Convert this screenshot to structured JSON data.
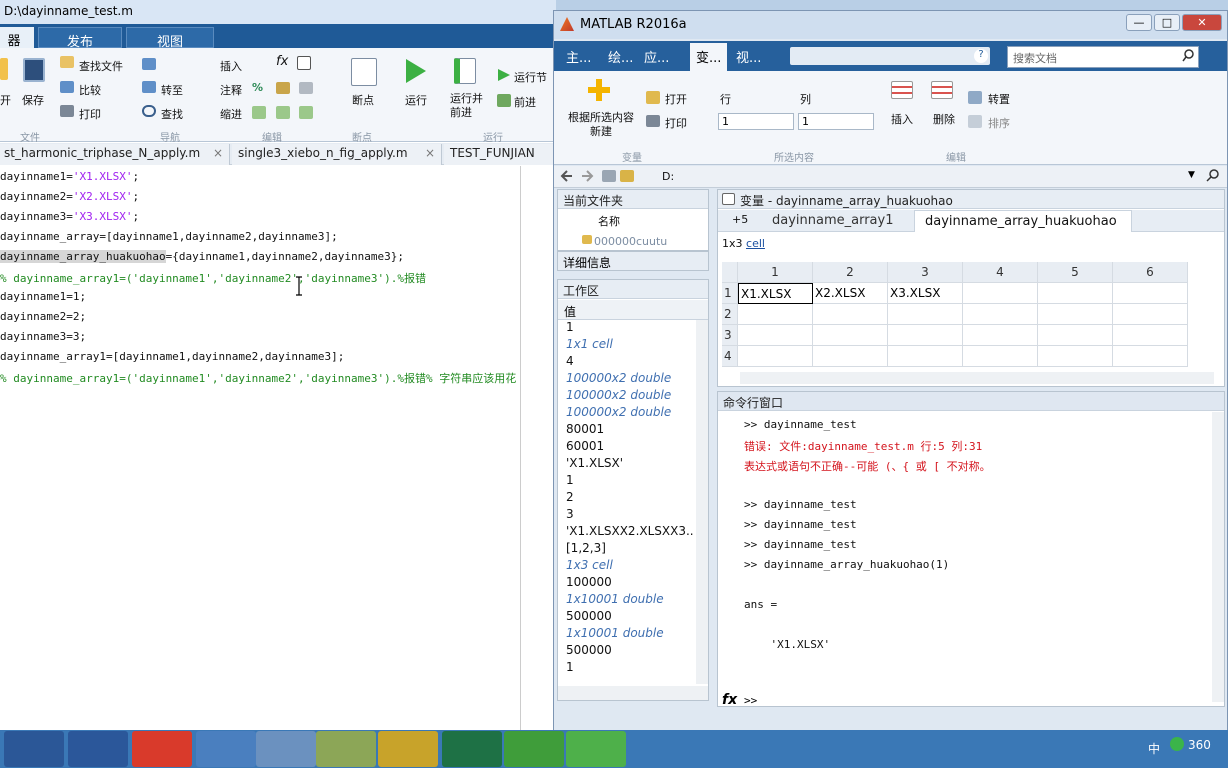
{
  "editor": {
    "title": "D:\\dayinname_test.m",
    "tabs": [
      "器",
      "发布",
      "视图"
    ],
    "ribbon": {
      "find_files": "查找文件",
      "compare": "比较",
      "print": "打印",
      "save": "保存",
      "open": "开",
      "goto": "转至",
      "find": "查找",
      "insert": "插入",
      "comment": "注释",
      "indent": "缩进",
      "breakpoint": "断点",
      "run": "运行",
      "run_advance": "运行并\n前进",
      "run_section": "运行节",
      "advance": "前进",
      "fx": "fx",
      "percent": "%",
      "groups": [
        "文件",
        "导航",
        "编辑",
        "断点",
        "运行"
      ]
    },
    "file_tabs": [
      "st_harmonic_triphase_N_apply.m",
      "single3_xiebo_n_fig_apply.m",
      "TEST_FUNJIAN"
    ],
    "file_tab_close": "×",
    "code_lines": [
      {
        "parts": [
          {
            "t": "dayinname1=",
            "c": ""
          },
          {
            "t": "'X1.XLSX'",
            "c": "st"
          },
          {
            "t": ";",
            "c": ""
          }
        ]
      },
      {
        "parts": [
          {
            "t": "dayinname2=",
            "c": ""
          },
          {
            "t": "'X2.XLSX'",
            "c": "st"
          },
          {
            "t": ";",
            "c": ""
          }
        ]
      },
      {
        "parts": [
          {
            "t": "dayinname3=",
            "c": ""
          },
          {
            "t": "'X3.XLSX'",
            "c": "st"
          },
          {
            "t": ";",
            "c": ""
          }
        ]
      },
      {
        "parts": [
          {
            "t": "dayinname_array=[dayinname1,dayinname2,dayinname3];",
            "c": ""
          }
        ]
      },
      {
        "parts": [
          {
            "t": "dayinname_array_huakuohao",
            "c": "hl"
          },
          {
            "t": "={dayinname1,dayinname2,dayinname3};",
            "c": ""
          }
        ]
      },
      {
        "parts": [
          {
            "t": "% dayinname_array1=('dayinname1','dayinname2','dayinname3').%报错",
            "c": "cm"
          }
        ]
      },
      {
        "parts": [
          {
            "t": "dayinname1=1;",
            "c": ""
          }
        ]
      },
      {
        "parts": [
          {
            "t": "dayinname2=2;",
            "c": ""
          }
        ]
      },
      {
        "parts": [
          {
            "t": "dayinname3=3;",
            "c": ""
          }
        ]
      },
      {
        "parts": [
          {
            "t": "dayinname_array1=[dayinname1,dayinname2,dayinname3];",
            "c": ""
          }
        ]
      },
      {
        "parts": [
          {
            "t": "% dayinname_array1=('dayinname1','dayinname2','dayinname3').%报错% 字符串应该用花",
            "c": "cm"
          }
        ]
      }
    ]
  },
  "matlab": {
    "title": "MATLAB R2016a",
    "tabs": [
      "主...",
      "绘...",
      "应...",
      "变...",
      "视..."
    ],
    "search_placeholder": "搜索文档",
    "ribbon": {
      "new_from_selection": "根据所选内容\n新建",
      "open": "打开",
      "print": "打印",
      "row_label": "行",
      "col_label": "列",
      "row_value": "1",
      "col_value": "1",
      "insert": "插入",
      "delete": "删除",
      "transpose": "转置",
      "sort": "排序",
      "groups": [
        "变量",
        "所选内容",
        "编辑"
      ]
    },
    "path_drive": "D:",
    "current_folder": {
      "title": "当前文件夹",
      "col_name": "名称",
      "item": "000000cuutu",
      "details": "详细信息"
    },
    "workspace": {
      "title": "工作区",
      "col_value": "值",
      "values": [
        {
          "v": "1",
          "i": false
        },
        {
          "v": "1x1 cell",
          "i": true
        },
        {
          "v": "4",
          "i": false
        },
        {
          "v": "100000x2 double",
          "i": true
        },
        {
          "v": "100000x2 double",
          "i": true
        },
        {
          "v": "100000x2 double",
          "i": true
        },
        {
          "v": "80001",
          "i": false
        },
        {
          "v": "60001",
          "i": false
        },
        {
          "v": "'X1.XLSX'",
          "i": false
        },
        {
          "v": "1",
          "i": false
        },
        {
          "v": "2",
          "i": false
        },
        {
          "v": "3",
          "i": false
        },
        {
          "v": "'X1.XLSXX2.XLSXX3...",
          "i": false
        },
        {
          "v": "[1,2,3]",
          "i": false
        },
        {
          "v": "1x3 cell",
          "i": true
        },
        {
          "v": "100000",
          "i": false
        },
        {
          "v": "1x10001 double",
          "i": true
        },
        {
          "v": "500000",
          "i": false
        },
        {
          "v": "1x10001 double",
          "i": true
        },
        {
          "v": "500000",
          "i": false
        },
        {
          "v": "1",
          "i": false
        }
      ]
    },
    "variables": {
      "title": "变量 - dayinname_array_huakuohao",
      "tab_plus": "+5",
      "tab1": "dayinname_array1",
      "tab2": "dayinname_array_huakuohao",
      "size_text": "1x3",
      "type_text": "cell",
      "col_headers": [
        "1",
        "2",
        "3",
        "4",
        "5",
        "6"
      ],
      "row_headers": [
        "1",
        "2",
        "3",
        "4"
      ],
      "row1": [
        "X1.XLSX",
        "X2.XLSX",
        "X3.XLSX",
        "",
        "",
        ""
      ]
    },
    "command": {
      "title": "命令行窗口",
      "lines": [
        {
          "t": ">> dayinname_test",
          "c": ""
        },
        {
          "t": "错误: 文件:dayinname_test.m 行:5 列:31",
          "c": "err"
        },
        {
          "t": "表达式或语句不正确--可能 (、{ 或 [ 不对称。",
          "c": "err"
        },
        {
          "t": "",
          "c": ""
        },
        {
          "t": ">> dayinname_test",
          "c": ""
        },
        {
          "t": ">> dayinname_test",
          "c": ""
        },
        {
          "t": ">> dayinname_test",
          "c": ""
        },
        {
          "t": ">> dayinname_array_huakuohao(1)",
          "c": ""
        },
        {
          "t": "",
          "c": ""
        },
        {
          "t": "ans =",
          "c": ""
        },
        {
          "t": "",
          "c": ""
        },
        {
          "t": "    'X1.XLSX'",
          "c": ""
        }
      ],
      "prompt_fx": "fx",
      "prompt": ">>"
    }
  },
  "taskbar": {
    "ime": "中",
    "app360": "360"
  }
}
